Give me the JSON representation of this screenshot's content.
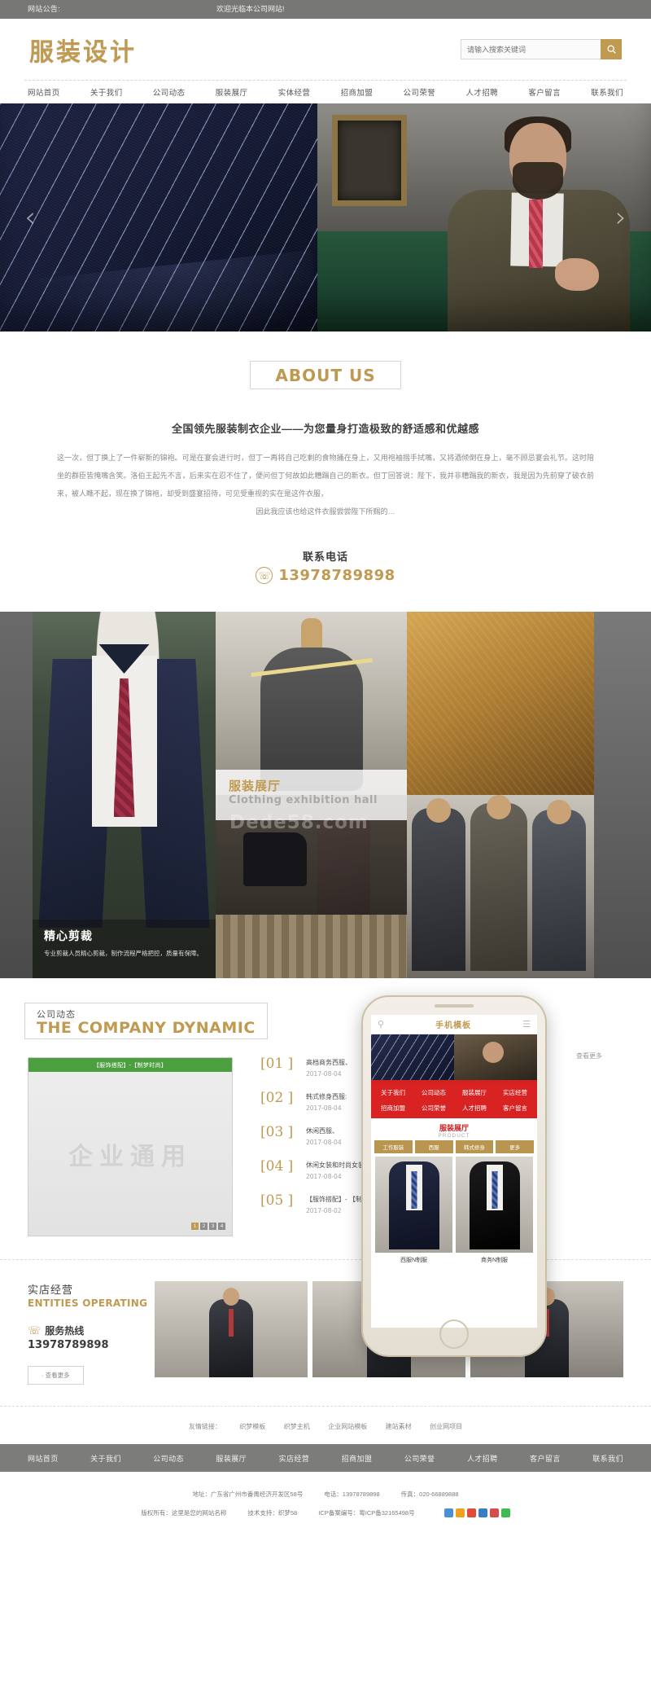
{
  "topbar": {
    "label": "网站公告:",
    "message": "欢迎光临本公司网站!"
  },
  "header": {
    "logo": "服装设计",
    "search_placeholder": "请输入搜索关键词",
    "search_value": "",
    "search_icon": "search-icon"
  },
  "nav": {
    "items": [
      {
        "label": "网站首页"
      },
      {
        "label": "关于我们"
      },
      {
        "label": "公司动态"
      },
      {
        "label": "服装展厅"
      },
      {
        "label": "实体经营"
      },
      {
        "label": "招商加盟"
      },
      {
        "label": "公司荣誉"
      },
      {
        "label": "人才招聘"
      },
      {
        "label": "客户留言"
      },
      {
        "label": "联系我们"
      }
    ]
  },
  "banner": {
    "prev_arrow": "‹",
    "next_arrow": "›"
  },
  "about": {
    "title": "ABOUT US",
    "subtitle": "全国领先服装制衣企业——为您量身打造极致的舒适感和优越感",
    "paragraph": "这一次，但丁换上了一件崭新的锦袍。可是在宴会进行时，但丁一再将自己吃剩的食物捅在身上，又用袍袖揩手拭嘴，又将酒倾倒在身上，毫不顾忌宴会礼节。这时陪坐的群臣皆掩嘴含笑。洛伯王起先不言，后来实在忍不住了，便问但丁何故如此糟蹋自己的新衣。但丁回答说：陛下，我并非糟蹋我的新衣，我是因为先前穿了破衣前来，被人瞧不起，现在换了锦袍，却受到盛宴招待，可见受重视的实在是这件衣服，",
    "paragraph_last": "因此我应该也给这件衣服尝尝陛下所赐的…",
    "contact_label": "联系电话",
    "contact_phone": "13978789898",
    "phone_icon": "phone-icon"
  },
  "gallery": {
    "label_cn": "服装展厅",
    "label_en": "Clothing exhibition hall",
    "watermark": "Dede58.com",
    "caption_cn": "精心剪裁",
    "caption_desc": "专业剪裁人员精心剪裁，制作流程严格把控，质量有保障。"
  },
  "news": {
    "heading_cn": "公司动态",
    "heading_en": "THE COMPANY DYNAMIC",
    "more": "查看更多",
    "slider_caption": "【服饰搭配】-【制梦时尚】",
    "slider_text": "企业通用",
    "slider_dots": [
      "1",
      "2",
      "3",
      "4"
    ],
    "items": [
      {
        "num": "[01 ]",
        "title": "高档商务西服、",
        "date": "2017-08-04"
      },
      {
        "num": "[02 ]",
        "title": "韩式修身西服:",
        "date": "2017-08-04"
      },
      {
        "num": "[03 ]",
        "title": "休闲西服、",
        "date": "2017-08-04"
      },
      {
        "num": "[04 ]",
        "title": "休闲女装和时尚女装",
        "date": "2017-08-04"
      },
      {
        "num": "[05 ]",
        "title": "【服饰搭配】- 【制梦",
        "date": "2017-08-02"
      }
    ]
  },
  "phone_mockup": {
    "title": "手机模板",
    "search_icon": "search-icon",
    "menu_icon": "hamburger-icon",
    "menu": [
      "关于我们",
      "公司动态",
      "服装展厅",
      "实店经营",
      "招商加盟",
      "公司荣誉",
      "人才招聘",
      "客户留言"
    ],
    "section_cn": "服装展厅",
    "section_en": "PRODUCT",
    "tabs": [
      "工作服装",
      "西服",
      "韩式修身",
      "更多"
    ],
    "products": [
      {
        "caption": "西服N制服"
      },
      {
        "caption": "商务N制服"
      }
    ]
  },
  "entities": {
    "title_cn": "实店经营",
    "title_en": "ENTITIES OPERATING",
    "hotline_label": "服务热线",
    "hotline_icon": "phone-icon",
    "hotline_number": "13978789898",
    "more_button": "· 查看更多"
  },
  "friend_links": {
    "label": "友情链接：",
    "items": [
      "织梦模板",
      "织梦主机",
      "企业网站模板",
      "建站素材",
      "创业网项目"
    ]
  },
  "footer_nav": {
    "items": [
      {
        "label": "网站首页"
      },
      {
        "label": "关于我们"
      },
      {
        "label": "公司动态"
      },
      {
        "label": "服装展厅"
      },
      {
        "label": "实店经营"
      },
      {
        "label": "招商加盟"
      },
      {
        "label": "公司荣誉"
      },
      {
        "label": "人才招聘"
      },
      {
        "label": "客户留言"
      },
      {
        "label": "联系我们"
      }
    ]
  },
  "footer": {
    "address": "地址：广东省广州市番禺经济开发区58号",
    "tel": "电话：13978789898",
    "fax": "传真：020-66889888",
    "copyright": "版权所有：这里是您的网站名称",
    "support": "技术支持：织梦58",
    "icp": "ICP备案编号：粤ICP备32165498号",
    "socials": [
      "share-plus-icon",
      "favorite-star-icon",
      "sina-weibo-icon",
      "qzone-icon",
      "renren-icon",
      "wechat-icon"
    ]
  },
  "colors": {
    "accent": "#c09a51",
    "topbar_bg": "#777776",
    "footer_nav_bg": "#7c7c7b",
    "news_slider_bar": "#4b9f3f",
    "phone_menu_red": "#d92222"
  }
}
